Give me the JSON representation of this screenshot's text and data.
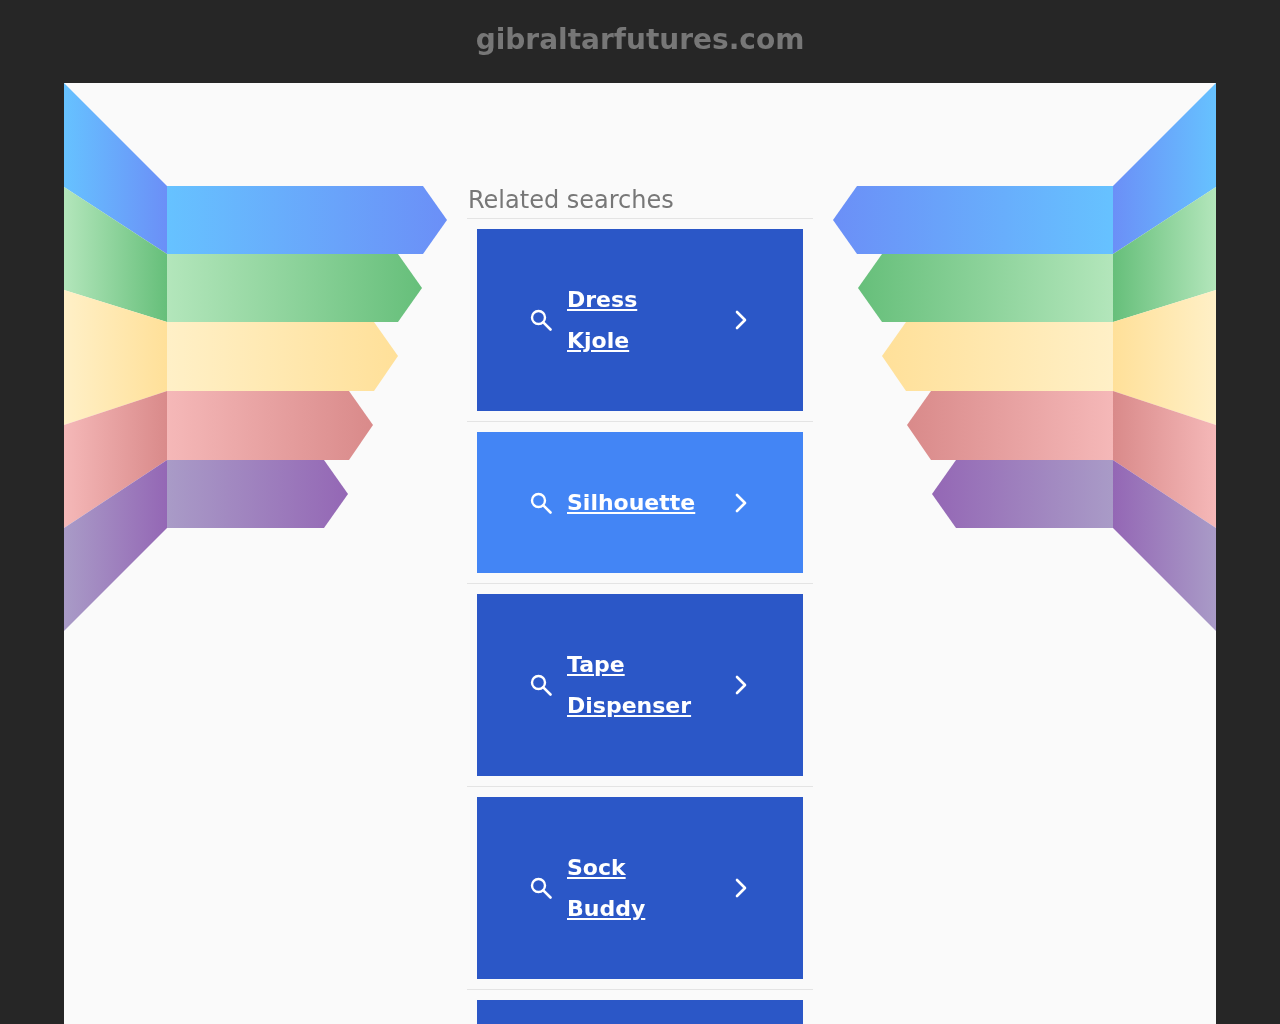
{
  "header": {
    "domain": "gibraltarfutures.com"
  },
  "related": {
    "heading": "Related searches",
    "searches": [
      {
        "label": "Dress Kjole",
        "selected": false
      },
      {
        "label": "Silhouette",
        "selected": true
      },
      {
        "label": "Tape Dispenser",
        "selected": false
      },
      {
        "label": "Sock Buddy",
        "selected": false
      }
    ]
  }
}
